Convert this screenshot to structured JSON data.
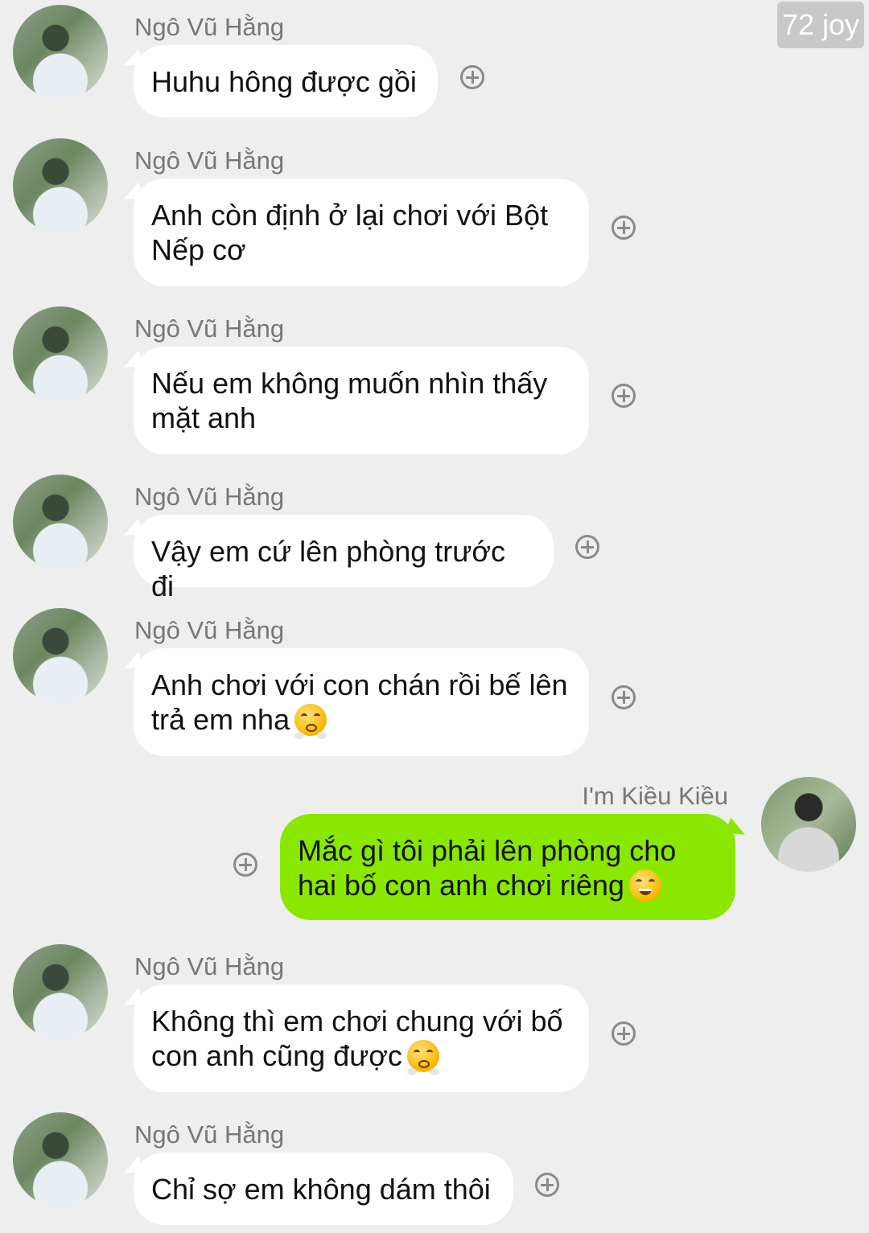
{
  "watermark": "72 joy",
  "colors": {
    "background": "#eeeeee",
    "incoming_bubble": "#ffffff",
    "outgoing_bubble": "#8ae800"
  },
  "messages": [
    {
      "sender": "Ngô Vũ Hằng",
      "text": "Huhu hông được gồi",
      "direction": "incoming"
    },
    {
      "sender": "Ngô Vũ Hằng",
      "text": "Anh còn định ở lại chơi với Bột Nếp cơ",
      "direction": "incoming"
    },
    {
      "sender": "Ngô Vũ Hằng",
      "text": "Nếu em không muốn nhìn thấy mặt anh",
      "direction": "incoming"
    },
    {
      "sender": "Ngô Vũ Hằng",
      "text": "Vậy em cứ lên phòng trước đi",
      "direction": "incoming"
    },
    {
      "sender": "Ngô Vũ Hằng",
      "text": "Anh chơi với con chán rồi bế lên trả em nha",
      "emoji": "face-with-steam-from-nose",
      "direction": "incoming"
    },
    {
      "sender": "I'm Kiều Kiều",
      "text": "Mắc gì tôi phải lên phòng cho hai bố con anh chơi riêng",
      "emoji": "grinning-face",
      "direction": "outgoing"
    },
    {
      "sender": "Ngô Vũ Hằng",
      "text": "Không thì em chơi chung với bố con anh cũng được",
      "emoji": "face-with-steam-from-nose",
      "direction": "incoming"
    },
    {
      "sender": "Ngô Vũ Hằng",
      "text": "Chỉ sợ em không dám thôi",
      "direction": "incoming"
    }
  ]
}
